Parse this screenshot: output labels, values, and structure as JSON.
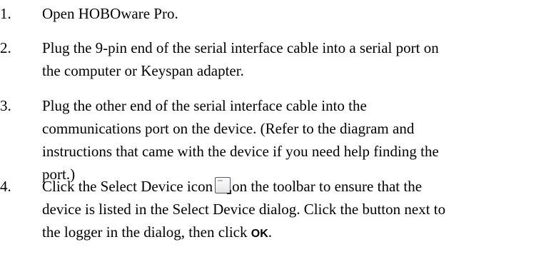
{
  "steps": [
    {
      "number": "1.",
      "text": "Open HOBOware Pro."
    },
    {
      "number": "2.",
      "line1": "Plug the 9-pin end of the serial interface cable into a serial port on",
      "line2": "the computer or Keyspan adapter."
    },
    {
      "number": "3.",
      "line1": "Plug the other end of the serial interface cable into the",
      "line2": "communications port on the device. (Refer to the diagram and",
      "line3": "instructions that came with the device if you need help finding the",
      "line4": "port.)"
    },
    {
      "number": "4.",
      "line1_before_icon": "Click the Select Device icon",
      "line1_after_icon": "on the toolbar to ensure that the",
      "line2": "device is listed in the Select Device dialog. Click the button next to",
      "line3_before_ok": "the logger in the dialog, then click",
      "ok_label": "OK",
      "line3_end": ".",
      "icon": "select-device-icon"
    }
  ]
}
